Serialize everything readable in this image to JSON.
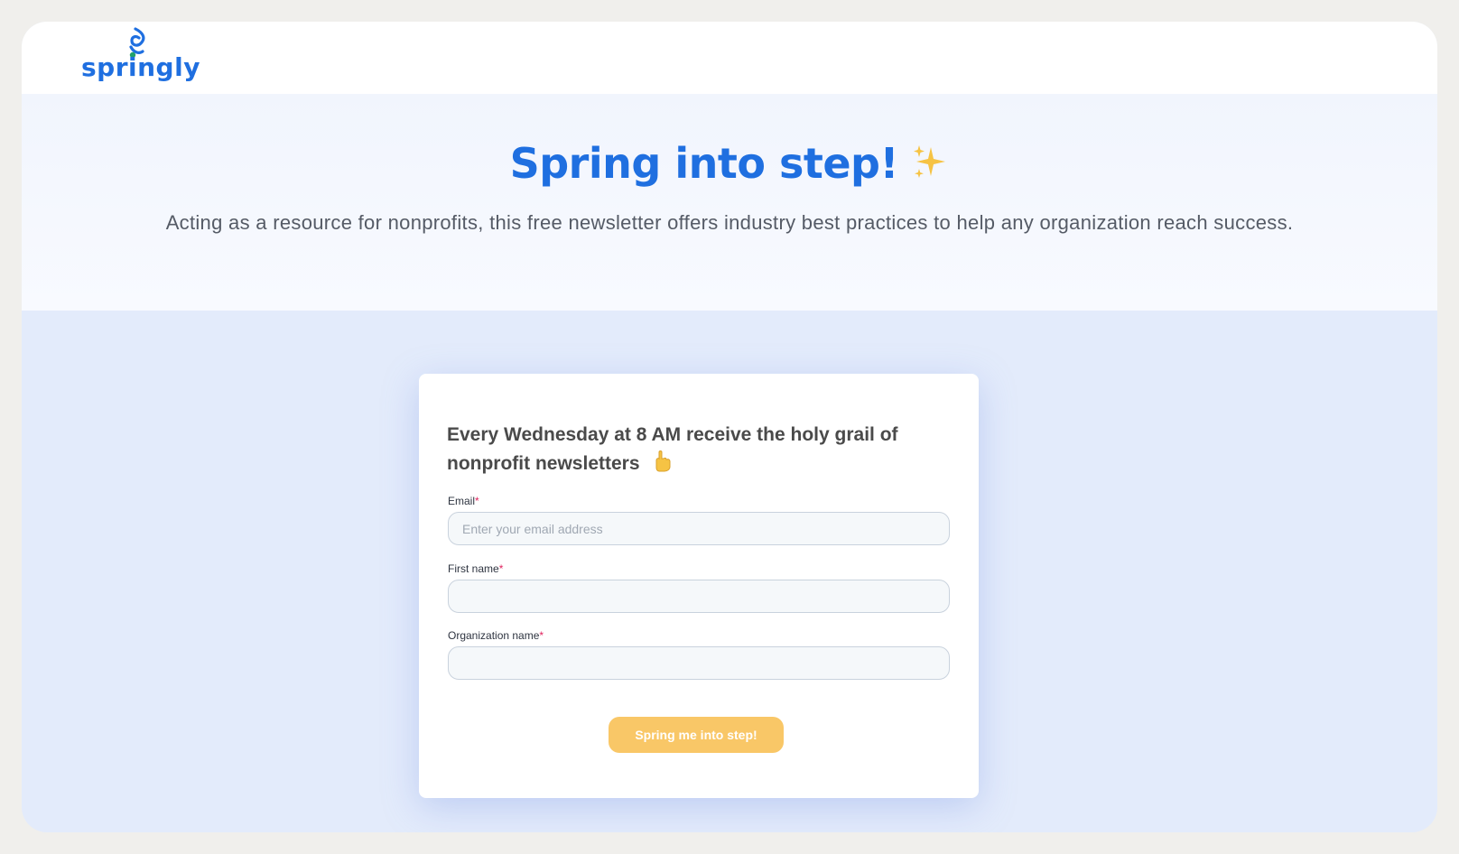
{
  "brand": {
    "logo_text": "springly",
    "logo_icon": "springly-swirl-icon",
    "primary_color": "#1f6fe0",
    "accent_color": "#22a06b"
  },
  "hero": {
    "title": "Spring into step!",
    "title_icon": "sparkles-icon",
    "subtitle": "Acting as a resource for nonprofits, this free newsletter offers industry best practices to help any organization reach success."
  },
  "form": {
    "heading": "Every Wednesday at 8 AM receive the holy grail of nonprofit newsletters",
    "heading_icon": "pointing-down-icon",
    "fields": [
      {
        "label": "Email",
        "required_mark": "*",
        "placeholder": "Enter your email address",
        "value": ""
      },
      {
        "label": "First name",
        "required_mark": "*",
        "placeholder": "",
        "value": ""
      },
      {
        "label": "Organization name",
        "required_mark": "*",
        "placeholder": "",
        "value": ""
      }
    ],
    "submit_label": "Spring me into step!",
    "submit_color": "#f9c767"
  }
}
